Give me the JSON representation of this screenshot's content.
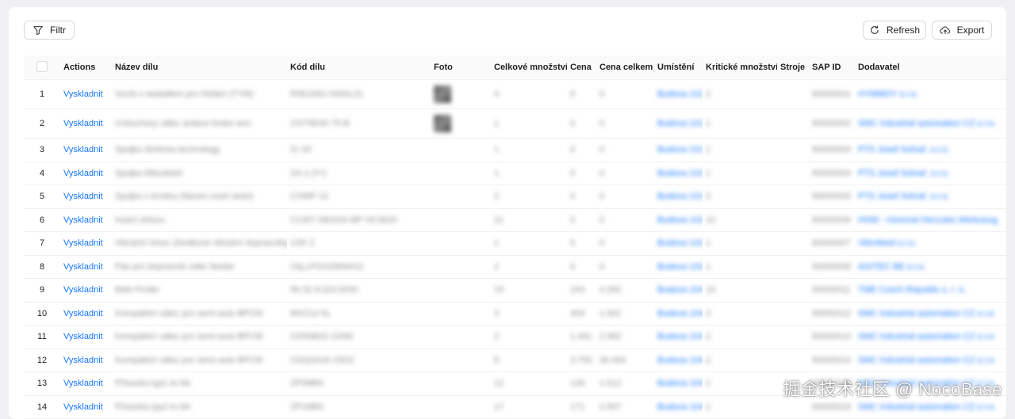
{
  "toolbar": {
    "filter_label": "Filtr",
    "refresh_label": "Refresh",
    "export_label": "Export"
  },
  "table": {
    "columns": [
      "",
      "Actions",
      "Název dílu",
      "Kód dílu",
      "Foto",
      "Celkové množství",
      "Cena",
      "Cena celkem",
      "Umístění",
      "Kritické množství",
      "Stroje",
      "SAP ID",
      "Dodavatel"
    ],
    "action_label": "Vyskladnit",
    "rows": [
      {
        "n": "1",
        "name": "Vozík s sedadlem pro hlídání (TYM)",
        "code": "R5E2061-5400L21",
        "photo": true,
        "qty": "4",
        "price": "0",
        "total": "0",
        "loc": "Budova 101",
        "crit": "2",
        "sap": "90000001",
        "sup": "HYMMOY s.r.o."
      },
      {
        "n": "2",
        "name": "Vzduchový válec ardace brake arm",
        "code": "CD75E40-75-B",
        "photo": true,
        "qty": "1",
        "price": "0",
        "total": "0",
        "loc": "Budova 101",
        "crit": "1",
        "sap": "90000002",
        "sup": "SMC Industrial automation CZ s.r.o."
      },
      {
        "n": "3",
        "name": "Spojka Sinfonia technology",
        "code": "IC-20",
        "photo": false,
        "qty": "1",
        "price": "0",
        "total": "0",
        "loc": "Budova 101",
        "crit": "1",
        "sap": "90000003",
        "sup": "PTS Josef Solnař, s.r.o."
      },
      {
        "n": "4",
        "name": "Spojka Mitsubishi",
        "code": "ZA-1.2Y1",
        "photo": false,
        "qty": "1",
        "price": "0",
        "total": "0",
        "loc": "Budova 102",
        "crit": "1",
        "sap": "90000004",
        "sup": "PTS Josef Solnař, s.r.o."
      },
      {
        "n": "5",
        "name": "Spojka s brzdou (Nexen ocelí sedo)",
        "code": "COMP 12",
        "photo": false,
        "qty": "2",
        "price": "0",
        "total": "0",
        "loc": "Budova 101",
        "crit": "2",
        "sap": "90000005",
        "sup": "PTS Josef Solnař, s.r.o."
      },
      {
        "n": "6",
        "name": "Insert uhlovu",
        "code": "CCMT 09020A MP HC3620",
        "photo": false,
        "qty": "21",
        "price": "0",
        "total": "0",
        "loc": "Budova 102",
        "crit": "10",
        "sap": "90000006",
        "sup": "HHW - Hommel Hercules Werkzeug"
      },
      {
        "n": "7",
        "name": "Vibrační hmoc (Dedkové vibrační dopravníky)",
        "code": "VZK 2",
        "photo": false,
        "qty": "1",
        "price": "0",
        "total": "0",
        "loc": "Budova 102",
        "crit": "1",
        "sap": "90000007",
        "sup": "Vibrofeed s.r.o."
      },
      {
        "n": "8",
        "name": "Pás pro dopravník roller feeder",
        "code": "Ckj.LP2019906411",
        "photo": false,
        "qty": "2",
        "price": "0",
        "total": "0",
        "loc": "Budova 103",
        "crit": "1",
        "sap": "90000008",
        "sup": "AGITEC BE s.r.o."
      },
      {
        "n": "9",
        "name": "Bekt Finder",
        "code": "56.32.9.024.0040",
        "photo": false,
        "qty": "19",
        "price": "244",
        "total": "4.392",
        "loc": "Budova 104",
        "crit": "10",
        "sap": "90000011",
        "sup": "TME Czech Republic s. r. o."
      },
      {
        "n": "10",
        "name": "Kompaktní válec pro semi-auto BPCM",
        "code": "MXZ12-5L",
        "photo": false,
        "qty": "3",
        "price": "404",
        "total": "1.502",
        "loc": "Budova 104",
        "crit": "3",
        "sap": "90000012",
        "sup": "SMC Industrial automation CZ s.r.o."
      },
      {
        "n": "11",
        "name": "Kompaktní válec pro semi-auto BPCM",
        "code": "CD55B32-100M",
        "photo": false,
        "qty": "2",
        "price": "1.491",
        "total": "2.982",
        "loc": "Budova 104",
        "crit": "2",
        "sap": "90000013",
        "sup": "SMC Industrial automation CZ s.r.o."
      },
      {
        "n": "12",
        "name": "Kompaktní válec pro semi-auto BPCM",
        "code": "CDQ2A16-15DZ",
        "photo": false,
        "qty": "8",
        "price": "3.759",
        "total": "30.064",
        "loc": "Budova 104",
        "crit": "2",
        "sap": "90000014",
        "sup": "SMC Industrial automation CZ s.r.o."
      },
      {
        "n": "13",
        "name": "Přísavka typ1 to 8A",
        "code": "ZP06BN",
        "photo": false,
        "qty": "12",
        "price": "126",
        "total": "1.512",
        "loc": "Budova 104",
        "crit": "1",
        "sap": "90000015",
        "sup": "SMC Industrial automation CZ s.r.o."
      },
      {
        "n": "14",
        "name": "Přísavka typ2 to 8A",
        "code": "ZP16BN",
        "photo": false,
        "qty": "17",
        "price": "171",
        "total": "2.907",
        "loc": "Budova 104",
        "crit": "1",
        "sap": "90000016",
        "sup": "SMC Industrial automation CZ s.r.o."
      }
    ]
  },
  "watermark": "掘金技术社区 @ NocoBase",
  "icons": {
    "filter": "filter-icon",
    "refresh": "refresh-icon",
    "export": "export-icon"
  },
  "colors": {
    "accent": "#1677ff",
    "background": "#f0f0f2"
  }
}
